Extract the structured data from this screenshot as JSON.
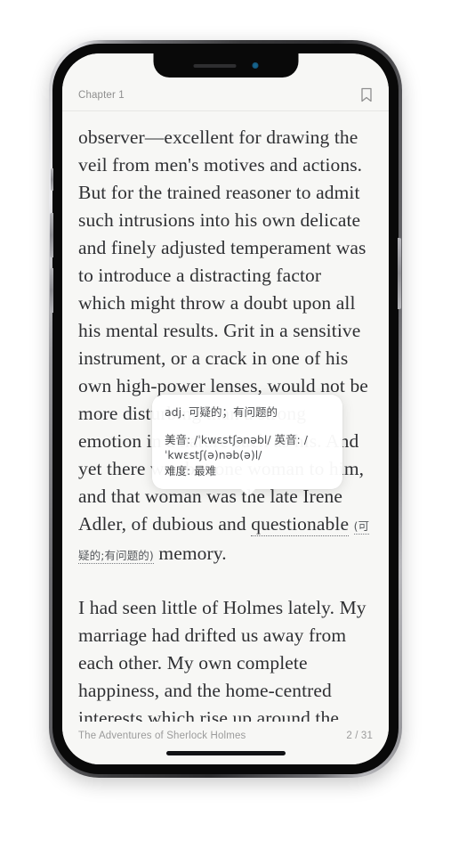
{
  "device": {
    "notch": {
      "speaker_icon": "speaker-grille",
      "camera_icon": "front-camera-dot"
    },
    "buttons": {
      "silent_switch": "silent-switch",
      "volume_up": "volume-up-button",
      "volume_down": "volume-down-button",
      "power": "power-button"
    },
    "home_indicator": "home-indicator-bar"
  },
  "reader": {
    "header": {
      "chapter": "Chapter 1",
      "bookmark_icon": "bookmark-icon"
    },
    "paragraphs": {
      "p1_before_word": "observer—excellent for drawing the veil from men's motives and actions. But for the trained reasoner to admit such intrusions into his own delicate and finely adjusted temperament was to introduce a distracting factor which might throw a doubt upon all his mental results. Grit in a sensitive instrument, or a crack in one of his own high-power lenses, would not be more disturbing than a strong emotion in a nature such as his. And yet there was but one woman to him, and that woman was the late Irene Adler, of dubious and ",
      "highlighted_word": "questionable",
      "inline_gloss": "(可疑的;有问题的)",
      "p1_after_word": " memory.",
      "p2": "I had seen little of Holmes lately. My marriage had drifted us away from each other. My own complete happiness, and the home-centred interests which rise up around the"
    },
    "tooltip": {
      "definition": "adj. 可疑的；有问题的",
      "pronunciation": "美音: /ˈkwɛstʃənəbl/  英音: /ˈkwɛstʃ(ə)nəb(ə)l/",
      "difficulty": "难度: 最难"
    },
    "footer": {
      "book_title": "The Adventures of Sherlock Holmes",
      "page_indicator": "2 / 31"
    }
  },
  "colors": {
    "screen_bg": "#f7f7f5",
    "body_text": "#2f3033",
    "muted_text": "#9b9b9b",
    "camera_blue": "#17658f"
  }
}
